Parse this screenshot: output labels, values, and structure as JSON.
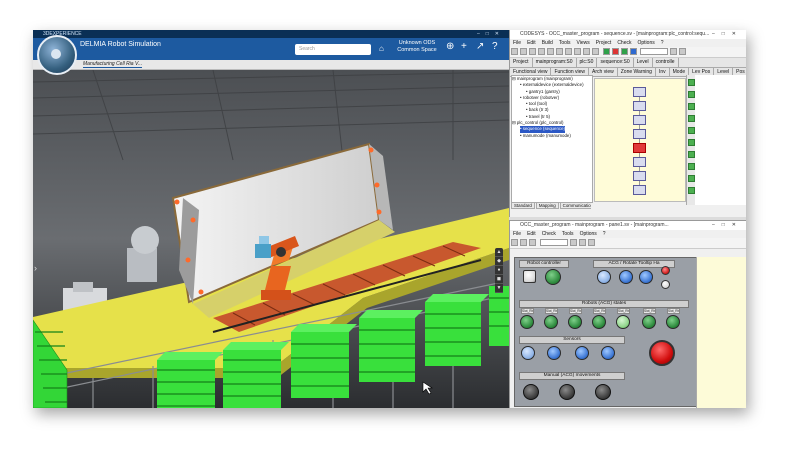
{
  "delmia": {
    "brand": "3DEXPERIENCE",
    "app_title": "DELMIA Robot Simulation",
    "search_placeholder": "Search",
    "user_line1": "Unknown ODS",
    "user_line2": "Common Space",
    "tab_label": "Manufacturing Cell Ria V..."
  },
  "twincat": {
    "title": "CODESYS - OCC_master_program - sequence.sv - [mainprogram:plc_control:sequ...",
    "menu": [
      "File",
      "Edit",
      "Build",
      "Tools",
      "Views",
      "Project",
      "Check",
      "Options",
      "?"
    ],
    "tabs": [
      "Project",
      "mainprogram:S0",
      "plc:S0",
      "sequence:S0",
      "Level",
      "controlle"
    ],
    "tabs2": [
      "Functional view",
      "Function view",
      "Arch view",
      "Zone Warning",
      "Inv",
      "Mode",
      "Lev Pos",
      "Level",
      "Pos",
      "contr"
    ],
    "tree": [
      {
        "label": "mainprogram (mainprogram)",
        "level": 0,
        "sel": false
      },
      {
        "label": "externaldevice (externaldevice)",
        "level": 1,
        "sel": false
      },
      {
        "label": "gantry1 (gantry)",
        "level": 2,
        "sel": false
      },
      {
        "label": "robotver (robotver)",
        "level": 1,
        "sel": false
      },
      {
        "label": "tool (tool)",
        "level": 2,
        "sel": false
      },
      {
        "label": "back (tr 3)",
        "level": 2,
        "sel": false
      },
      {
        "label": "travel (tr 5)",
        "level": 2,
        "sel": false
      },
      {
        "label": "plc_control (plc_control)",
        "level": 0,
        "sel": false
      },
      {
        "label": "sequence (sequence)",
        "level": 1,
        "sel": true
      },
      {
        "label": "manumode (manumode)",
        "level": 1,
        "sel": false
      }
    ],
    "bottom_tabs": [
      "Standard",
      "Mapping",
      "Communication"
    ]
  },
  "hmi_window": {
    "title": "OCC_master_program - mainprogram - pane1.sv - [mainprogram...",
    "menu": [
      "File",
      "Edit",
      "Check",
      "Tools",
      "Options",
      "?"
    ],
    "groups": {
      "robot_controller": "Robot controller",
      "acg_rotate": "ACG / Rotate Tooltip Ha",
      "robots": "Robots (ACG) states",
      "sensors": "Sensors",
      "manual": "Manual (ACG) movements"
    },
    "sublabels": [
      "Slot_Rb1",
      "Slot_Rb2",
      "Slot_Rb3",
      "Slot_Rb4",
      "Slot_Rb5",
      "Slot_Rb6",
      "Slot_Rb7"
    ]
  },
  "colors": {
    "delmia_bar": "#1d5aa0",
    "delmia_top": "#0a2f55",
    "floor": "#e6e14a",
    "rack_green": "#36e03a",
    "hmi_bg": "#9a9fa6"
  }
}
